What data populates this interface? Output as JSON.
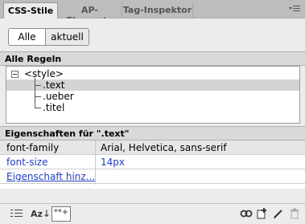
{
  "tabs": [
    {
      "label": "CSS-Stile"
    },
    {
      "label": "AP-Elemente"
    },
    {
      "label": "Tag-Inspektor"
    }
  ],
  "filter": {
    "all_label": "Alle",
    "current_label": "aktuell"
  },
  "rules_section": {
    "title": "Alle Regeln",
    "root": "<style>",
    "items": [
      {
        "label": ".text",
        "selected": true
      },
      {
        "label": ".ueber",
        "selected": false
      },
      {
        "label": ".titel",
        "selected": false
      }
    ]
  },
  "properties_section": {
    "title": "Eigenschaften für \".text\"",
    "rows": [
      {
        "name": "font-family",
        "value": "Arial, Helvetica, sans-serif"
      },
      {
        "name": "font-size",
        "value": "14px"
      }
    ],
    "add_label": "Eigenschaft hinz..."
  },
  "toolbar": {
    "icons": [
      "category-view-icon",
      "alphabetical-view-icon",
      "set-properties-icon",
      "attach-stylesheet-icon",
      "new-rule-icon",
      "edit-icon",
      "delete-icon"
    ],
    "az_label": "Az",
    "star_label": "**+"
  }
}
